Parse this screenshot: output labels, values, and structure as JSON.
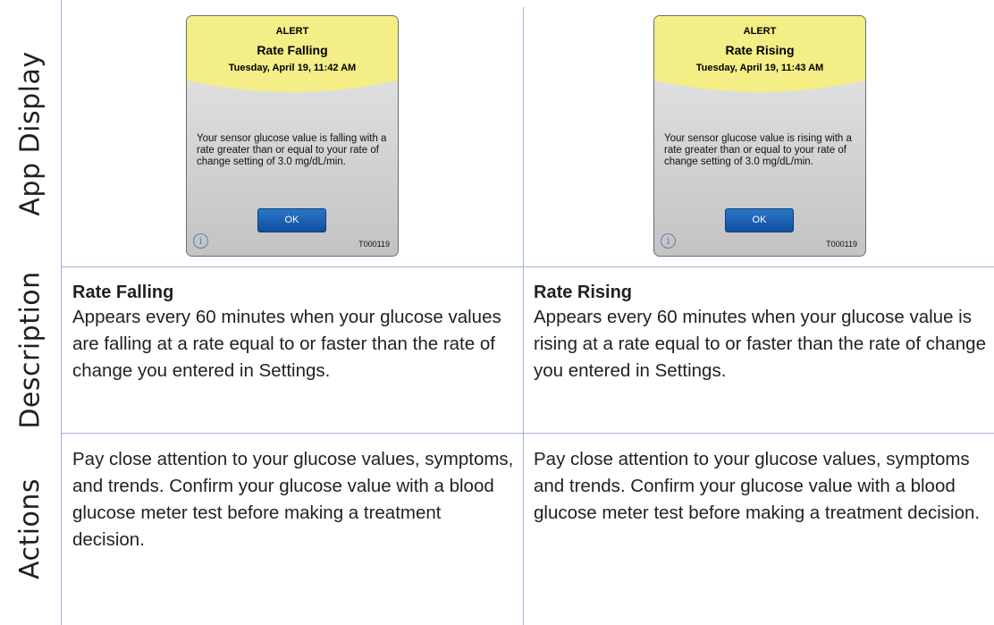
{
  "row_labels": {
    "app_display": "App Display",
    "description": "Description",
    "actions": "Actions"
  },
  "columns": [
    {
      "screen": {
        "alert": "ALERT",
        "title": "Rate Falling",
        "date": "Tuesday, April 19, 11:42 AM",
        "message": "Your sensor glucose value is falling with a rate greater than or equal to your rate of change setting of 3.0 mg/dL/min.",
        "ok_label": "OK",
        "info_glyph": "i",
        "code": "T000119"
      },
      "description_title": "Rate Falling",
      "description_body": "Appears every 60 minutes when your glucose values are falling at a rate equal to or faster than the rate of change you entered in Settings.",
      "actions_body": "Pay close attention to your glucose values, symptoms, and trends. Confirm your glucose value with a blood glucose meter test before making a treatment decision."
    },
    {
      "screen": {
        "alert": "ALERT",
        "title": "Rate Rising",
        "date": "Tuesday, April 19, 11:43 AM",
        "message": "Your sensor glucose value is rising with a rate greater than or equal to your rate of change setting of 3.0 mg/dL/min.",
        "ok_label": "OK",
        "info_glyph": "i",
        "code": "T000119"
      },
      "description_title": "Rate Rising",
      "description_body": "Appears every 60 minutes when your glucose value is rising at a rate equal to or faster than the rate of change you entered in Settings.",
      "actions_body": "Pay close attention to your glucose values, symptoms and trends. Confirm your glucose value with a blood glucose meter test before making a treatment decision."
    }
  ],
  "colors": {
    "header_yellow": "#f3ee85",
    "grid_line": "#9fb4d8",
    "ok_button": "#1c5fb0"
  }
}
